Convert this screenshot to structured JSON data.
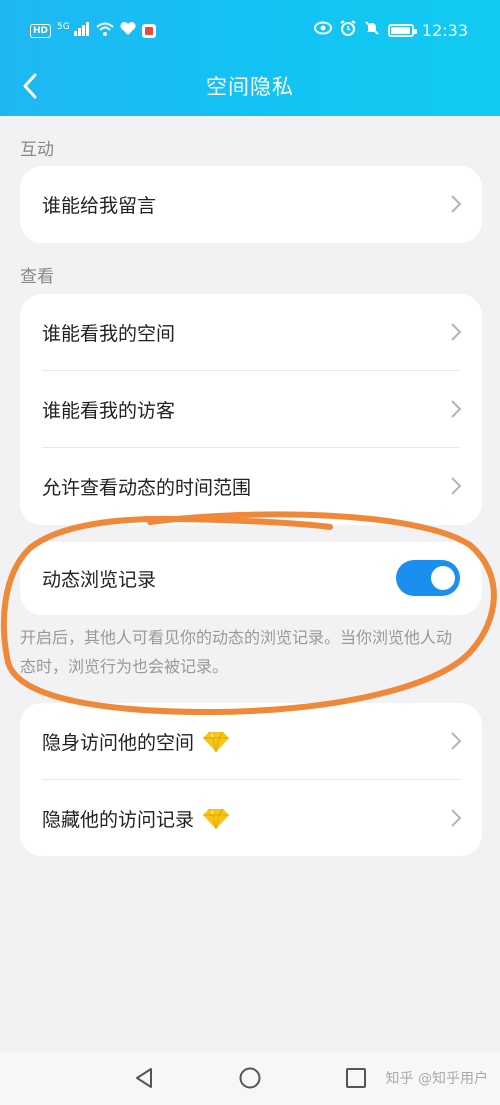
{
  "status_bar": {
    "hd_badge": "HD",
    "network": "5G",
    "time": "12:33",
    "icons": [
      "signal-icon",
      "wifi-icon",
      "heart-icon",
      "app-notification-icon",
      "eye-icon",
      "alarm-icon",
      "mute-icon",
      "battery-icon"
    ]
  },
  "nav": {
    "title": "空间隐私",
    "back_icon": "back-arrow-icon"
  },
  "sections": {
    "interaction": {
      "label": "互动",
      "rows": [
        {
          "label": "谁能给我留言"
        }
      ]
    },
    "view": {
      "label": "查看",
      "rows": [
        {
          "label": "谁能看我的空间"
        },
        {
          "label": "谁能看我的访客"
        },
        {
          "label": "允许查看动态的时间范围"
        }
      ]
    },
    "browse_record": {
      "label": "动态浏览记录",
      "toggle_on": true,
      "description": "开启后，其他人可看见你的动态的浏览记录。当你浏览他人动态时，浏览行为也会被记录。"
    },
    "vip": {
      "rows": [
        {
          "label": "隐身访问他的空间",
          "icon": "diamond-icon"
        },
        {
          "label": "隐藏他的访问记录",
          "icon": "diamond-icon"
        }
      ]
    }
  },
  "colors": {
    "header_gradient_start": "#1fb7f2",
    "header_gradient_end": "#12cbf0",
    "toggle_on": "#1a8ff0",
    "annotation": "#f0883a",
    "diamond": "#f5c518"
  },
  "bottom_nav": {
    "icons": [
      "back-triangle-icon",
      "home-circle-icon",
      "recents-square-icon"
    ],
    "watermark": "知乎 @知乎用户"
  }
}
